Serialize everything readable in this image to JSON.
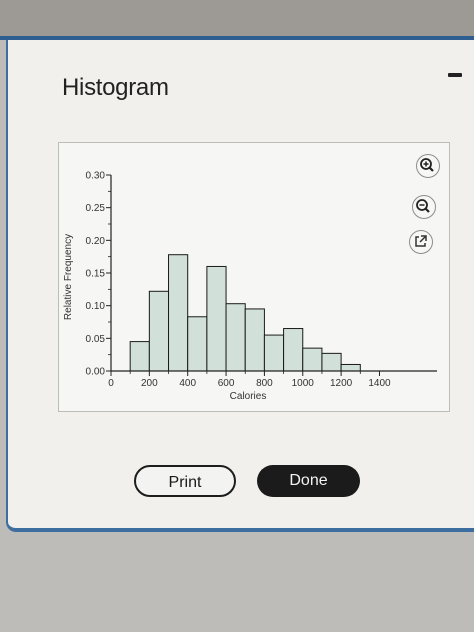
{
  "dialog": {
    "title": "Histogram",
    "buttons": {
      "print": "Print",
      "done": "Done"
    }
  },
  "toolbar": {
    "zoom_in": "zoom-in-icon",
    "zoom_out": "zoom-out-icon",
    "pop_out": "pop-out-icon"
  },
  "colors": {
    "bar_fill": "#d2e0da",
    "bar_stroke": "#1a1a1a",
    "accent": "#2f5e91"
  },
  "chart_data": {
    "type": "bar",
    "title": "",
    "xlabel": "Calories",
    "ylabel": "Relative Frequency",
    "bin_width": 100,
    "bins": [
      {
        "x0": 100,
        "x1": 200,
        "value": 0.045
      },
      {
        "x0": 200,
        "x1": 300,
        "value": 0.122
      },
      {
        "x0": 300,
        "x1": 400,
        "value": 0.178
      },
      {
        "x0": 400,
        "x1": 500,
        "value": 0.083
      },
      {
        "x0": 500,
        "x1": 600,
        "value": 0.16
      },
      {
        "x0": 600,
        "x1": 700,
        "value": 0.103
      },
      {
        "x0": 700,
        "x1": 800,
        "value": 0.095
      },
      {
        "x0": 800,
        "x1": 900,
        "value": 0.055
      },
      {
        "x0": 900,
        "x1": 1000,
        "value": 0.065
      },
      {
        "x0": 1000,
        "x1": 1100,
        "value": 0.035
      },
      {
        "x0": 1100,
        "x1": 1200,
        "value": 0.027
      },
      {
        "x0": 1200,
        "x1": 1300,
        "value": 0.01
      }
    ],
    "xlim": [
      0,
      1700
    ],
    "ylim": [
      0,
      0.3
    ],
    "xticks": [
      0,
      200,
      400,
      600,
      800,
      1000,
      1200,
      1400
    ],
    "xtick_labels": [
      "0",
      "200",
      "400",
      "600",
      "800",
      "1000",
      "1200",
      "1400"
    ],
    "yticks": [
      0,
      0.05,
      0.1,
      0.15,
      0.2,
      0.25,
      0.3
    ],
    "ytick_labels": [
      "0.00",
      "0.05",
      "0.10",
      "0.15",
      "0.20",
      "0.25",
      "0.30"
    ],
    "grid": false
  }
}
